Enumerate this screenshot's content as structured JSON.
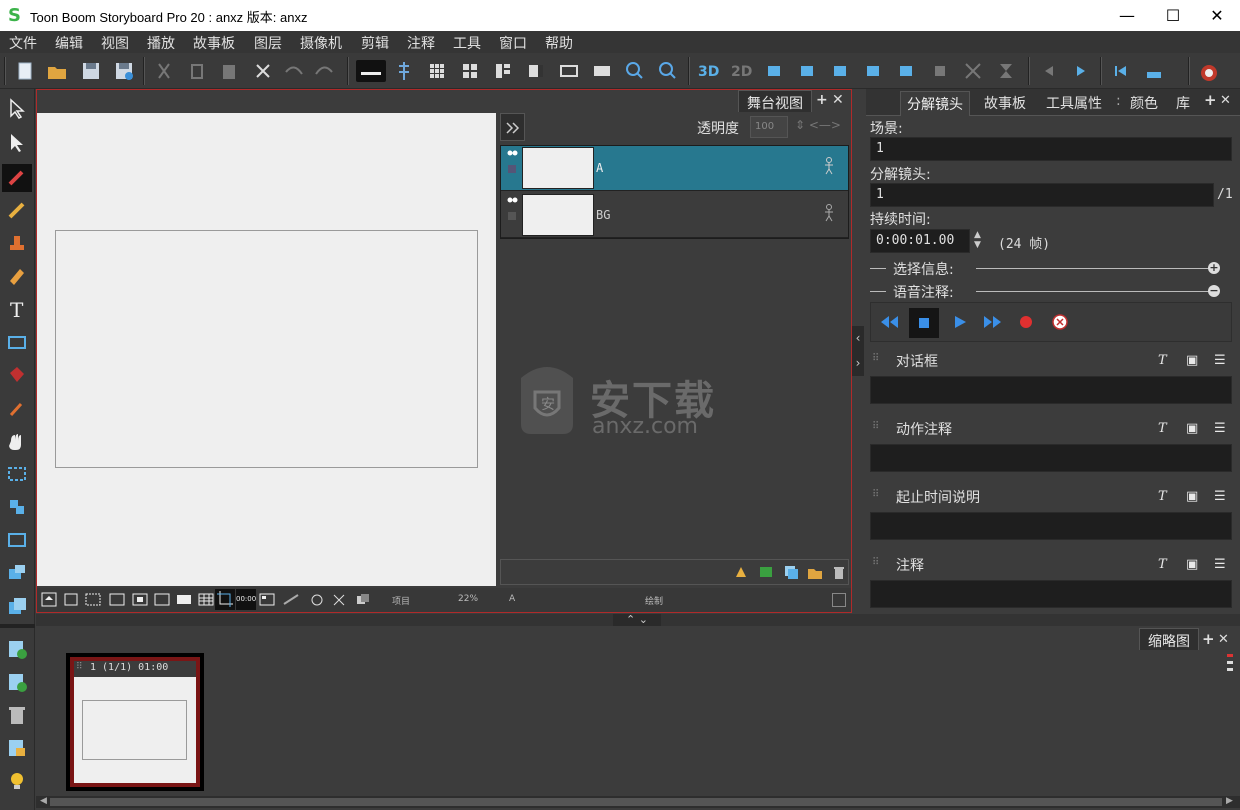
{
  "window": {
    "title": "Toon Boom Storyboard Pro 20 : anxz 版本: anxz",
    "logo": "S"
  },
  "menu": [
    "文件",
    "编辑",
    "视图",
    "播放",
    "故事板",
    "图层",
    "摄像机",
    "剪辑",
    "注释",
    "工具",
    "窗口",
    "帮助"
  ],
  "stage": {
    "tab_label": "舞台视图",
    "opacity_label": "透明度",
    "opacity_value": "100",
    "layers": [
      {
        "name": "A",
        "selected": true
      },
      {
        "name": "BG",
        "selected": false
      }
    ],
    "bottom_labels": {
      "item": "项目",
      "zoom": "22%",
      "layer": "A",
      "mode": "绘制"
    }
  },
  "right": {
    "tabs": [
      "分解镜头",
      "故事板",
      "工具属性",
      "颜色",
      "库"
    ],
    "scene_label": "场景:",
    "scene_value": "1",
    "panel_label": "分解镜头:",
    "panel_value": "1",
    "panel_total": "/1",
    "duration_label": "持续时间:",
    "duration_value": "0:00:01.00",
    "duration_frames": "(24 帧)",
    "selection_info": "选择信息:",
    "voice_notes": "语音注释:",
    "sections": [
      "对话框",
      "动作注释",
      "起止时间说明",
      "注释"
    ]
  },
  "thumbnails": {
    "tab_label": "缩略图",
    "panel_caption": "1 (1/1) 01:00"
  },
  "watermark": {
    "text": "安下载",
    "sub": "anxz.com",
    "badge": "安"
  },
  "colors": {
    "accent": "#2a7f96",
    "selection_red": "#b02a2a"
  }
}
